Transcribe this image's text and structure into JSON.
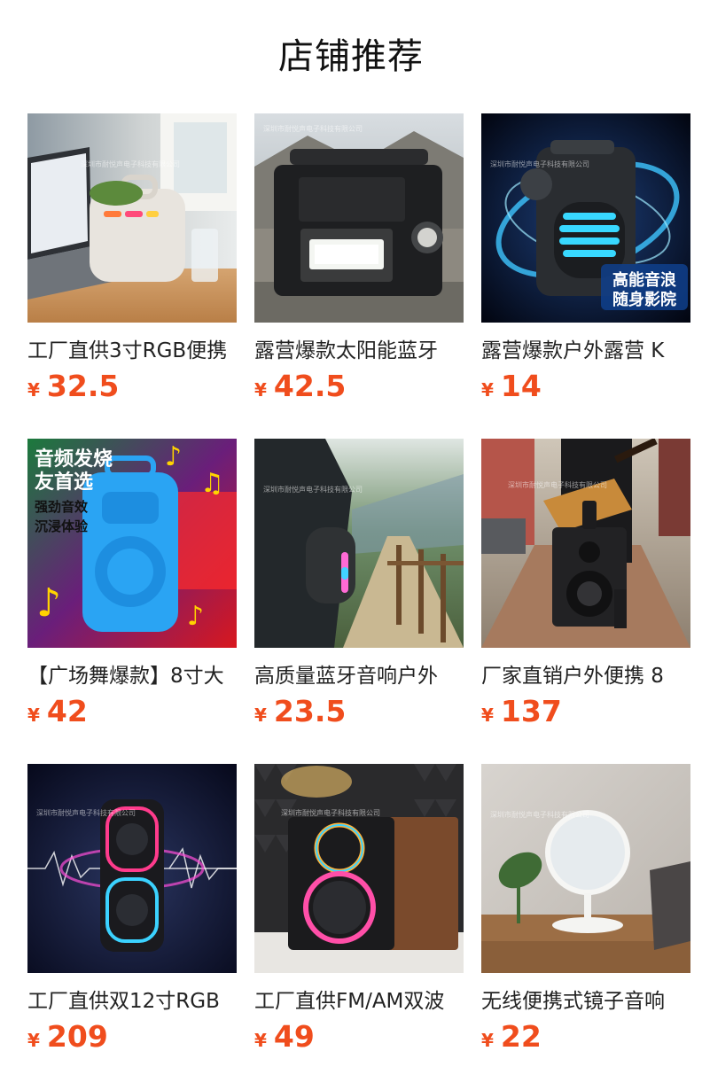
{
  "section": {
    "title": "店铺推荐"
  },
  "currency_symbol": "¥",
  "products": [
    {
      "name": "工厂直供3寸RGB便携",
      "price": "32.5",
      "icon": "white-portable-speaker-image"
    },
    {
      "name": "露营爆款太阳能蓝牙",
      "price": "42.5",
      "icon": "solar-camping-lantern-speaker-image"
    },
    {
      "name": "露营爆款户外露营 K",
      "price": "14",
      "icon": "blue-glowing-speaker-image",
      "overlay_text": "高能音浪 随身影院"
    },
    {
      "name": "【广场舞爆款】8寸大",
      "price": "42",
      "icon": "blue-square-dance-speaker-image",
      "overlay_lines": [
        "音频发烧",
        "友首选",
        "强劲音效",
        "沉浸体验"
      ]
    },
    {
      "name": "高质量蓝牙音响户外",
      "price": "23.5",
      "icon": "backpack-hiking-speaker-image"
    },
    {
      "name": "厂家直销户外便携 8",
      "price": "137",
      "icon": "street-guitar-trolley-speaker-image"
    },
    {
      "name": "工厂直供双12寸RGB",
      "price": "209",
      "icon": "rgb-dual-woofer-speaker-image"
    },
    {
      "name": "工厂直供FM/AM双波",
      "price": "49",
      "icon": "rgb-desktop-speaker-image"
    },
    {
      "name": "无线便携式镜子音响",
      "price": "22",
      "icon": "mirror-speaker-image"
    }
  ],
  "watermark": "深圳市耐悦声电子科技有限公司",
  "colors": {
    "price": "#f04d1d",
    "title": "#111111",
    "text": "#222222"
  }
}
